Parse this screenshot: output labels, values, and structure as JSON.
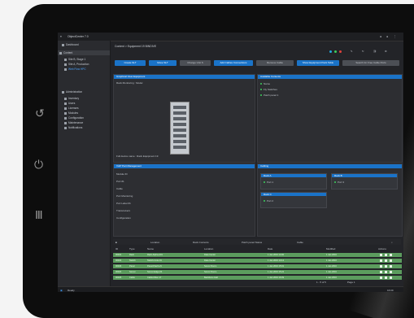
{
  "device": {
    "side_buttons": [
      "↺",
      "⏻",
      "Ⅲ"
    ]
  },
  "app": {
    "title": "ObjectCenter 7.0",
    "status_dots": [
      "#21a8e0",
      "#3ccf5e",
      "#e0413b"
    ]
  },
  "sidebar": {
    "items": [
      {
        "label": "Dashboard",
        "icon": "grid-icon"
      },
      {
        "label": "Content",
        "icon": "folder-icon",
        "selected": true
      },
      {
        "label": "Site B, Stage 1",
        "icon": "location-icon"
      },
      {
        "label": "Site A, Production",
        "icon": "location-icon"
      },
      {
        "label": "Web Flow HPC",
        "icon": "location-icon"
      },
      {
        "label": "Administration",
        "icon": "gear-icon"
      },
      {
        "label": "Inventory",
        "icon": "box-icon"
      },
      {
        "label": "Users",
        "icon": "user-icon"
      },
      {
        "label": "Licenses",
        "icon": "key-icon"
      },
      {
        "label": "Modules",
        "icon": "puzzle-icon"
      },
      {
        "label": "Configuration",
        "icon": "wrench-icon"
      },
      {
        "label": "Maintenance",
        "icon": "tool-icon"
      },
      {
        "label": "Notifications",
        "icon": "bell-icon"
      }
    ]
  },
  "breadcrumb": "Content  >  Equipment 19 BINDIVE",
  "toolbar": [
    {
      "label": "Create SLT",
      "style": "blue"
    },
    {
      "label": "Move SLT",
      "style": "blue"
    },
    {
      "label": "Change Unit S",
      "style": "gray"
    },
    {
      "label": "Add Cables Connections",
      "style": "blue"
    },
    {
      "label": "Remove Cable",
      "style": "gray"
    },
    {
      "label": "Show Equipment Pack Table",
      "style": "blue"
    },
    {
      "label": "Search for Free Cable Ports",
      "style": "gray"
    }
  ],
  "panels": {
    "overview": {
      "title": "Graphical View Equipment",
      "line": "Rack Monitoring :  Model",
      "footer": "Full device name  :  Rack Equipment 19"
    },
    "contents": {
      "title": "Available Contents",
      "items": [
        "Name",
        "Fly Switches",
        "Patch panel 1"
      ]
    },
    "ports": {
      "title": "VoIP Part Management",
      "items": [
        "Module ID",
        "Port #1",
        "Cable",
        "Port Monitoring",
        "Port Label #1",
        "Transceivers",
        "Configuration"
      ]
    },
    "cabling": {
      "title": "Cabling",
      "cards": [
        {
          "title": "Rack A",
          "value": "Port 1"
        },
        {
          "title": "Rack B",
          "value": "Port 3"
        },
        {
          "title": "Rack C",
          "value": "Port 2"
        }
      ]
    }
  },
  "table": {
    "filters": [
      "Location",
      "Rack Contents",
      "Patch panel Status",
      "Cable"
    ],
    "columns": [
      "ID",
      "Type",
      "Name",
      "Location",
      "Date",
      "Modified",
      "Actions"
    ],
    "rows": [
      [
        "00021",
        "Rack",
        "Rack-Alpha-A01",
        "Data Center",
        "1 Jan 2016 14:00",
        "1 Jan 2016"
      ],
      [
        "00022",
        "Switch",
        "Switch-Core-01",
        "Data Center",
        "1 Jan 2016 14:12",
        "1 Jan 2016"
      ],
      [
        "00023",
        "Panel",
        "Panel-Patch-21",
        "Server Room",
        "1 Jan 2016 15:01",
        "1 Jan 2016"
      ],
      [
        "00024",
        "Server",
        "Server-Edge-04",
        "Server Room",
        "1 Jan 2016 15:22",
        "1 Jan 2016"
      ],
      [
        "00025",
        "Cable",
        "Cable-Fiber-17",
        "Backbone Hall",
        "1 Jan 2016 16:09",
        "1 Jan 2016"
      ]
    ]
  },
  "footer": {
    "pager": "1 - 5 of 5",
    "right": "Page 1",
    "status": "Ready",
    "clock": "16:09"
  }
}
